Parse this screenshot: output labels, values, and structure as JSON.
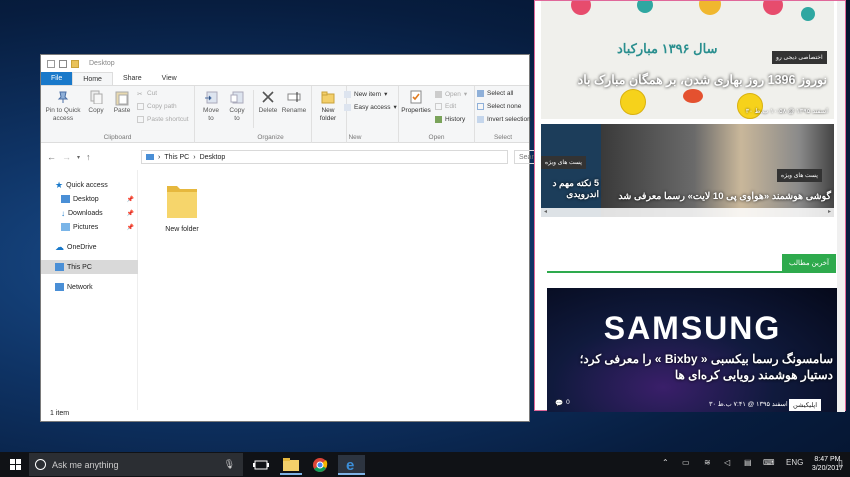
{
  "explorer": {
    "title": "Desktop",
    "tabs": [
      "File",
      "Home",
      "Share",
      "View"
    ],
    "clipboard": {
      "pin": "Pin to Quick access",
      "copy": "Copy",
      "paste": "Paste",
      "cut": "Cut",
      "copy_path": "Copy path",
      "paste_shortcut": "Paste shortcut",
      "label": "Clipboard"
    },
    "organize": {
      "move_to": "Move to",
      "copy_to": "Copy to",
      "delete": "Delete",
      "rename": "Rename",
      "label": "Organize"
    },
    "new": {
      "new_folder": "New folder",
      "new_item": "New item",
      "easy_access": "Easy access",
      "label": "New"
    },
    "open": {
      "properties": "Properties",
      "open": "Open",
      "edit": "Edit",
      "history": "History",
      "label": "Open"
    },
    "select": {
      "select_all": "Select all",
      "select_none": "Select none",
      "invert": "Invert selection",
      "label": "Select"
    },
    "address": [
      "This PC",
      "Desktop"
    ],
    "search_placeholder": "Search Desktop",
    "nav": {
      "quick_access": "Quick access",
      "desktop": "Desktop",
      "downloads": "Downloads",
      "pictures": "Pictures",
      "onedrive": "OneDrive",
      "this_pc": "This PC",
      "network": "Network"
    },
    "folder_name": "New folder",
    "status": "1 item"
  },
  "edge": {
    "banner_year": "سال ۱۳۹۶ مبارکباد",
    "banner_badge": "اختصاصی دیجی رو",
    "banner_title": "نوروز 1396 روز بهاری شدن، بر همگان مبارک باد",
    "banner_date": "۳۰ اسفند ۱۳۹۵ @ ۱۰:۵۸ ب.ظ",
    "left_badge": "پست های ویژه",
    "left_title": "5 نکته مهم د اندرویدی",
    "right_badge": "پست های ویژه",
    "right_title": "گوشی هوشمند «هواوی پی 10 لایت» رسما معرفی شد",
    "latest": "آخرین مطالب",
    "samsung_logo": "SAMSUNG",
    "samsung_title": "سامسونگ رسما بیکسبی « Bixby » را معرفی کرد؛ دستیار هوشمند رویایی کره‌ای ها",
    "samsung_tag": "اپلیکیشن",
    "samsung_date": "۳۰ اسفند ۱۳۹۵ @ ۷:۴۱ ب.ظ",
    "comments": "0"
  },
  "taskbar": {
    "search": "Ask me anything",
    "lang": "ENG",
    "time": "8:47 PM",
    "date": "3/20/2017"
  }
}
